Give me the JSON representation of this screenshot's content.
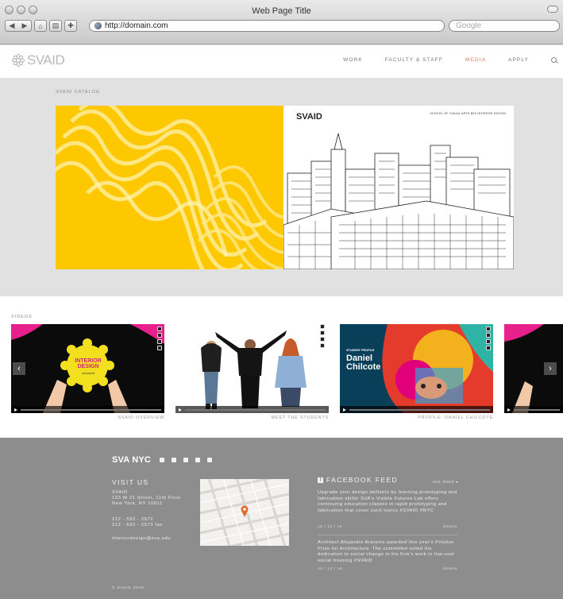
{
  "browser": {
    "title": "Web Page Title",
    "url": "http://domain.com",
    "search_placeholder": "Google"
  },
  "site": {
    "logo_text": "SVAID",
    "nav": [
      {
        "label": "WORK",
        "active": false
      },
      {
        "label": "FACULTY & STAFF",
        "active": false
      },
      {
        "label": "MEDIA",
        "active": true
      },
      {
        "label": "APPLY",
        "active": false
      }
    ],
    "active_color": "#e8766a"
  },
  "catalog": {
    "label": "SVAID CATALOG",
    "cover_logo": "SVAID",
    "cover_subtitle": "SCHOOL OF VISUAL ARTS BFA INTERIOR DESIGN",
    "accent": "#fdc800"
  },
  "videos": {
    "label": "VIDEOS",
    "items": [
      {
        "caption": "SVAID OVERVIEW",
        "overlay": "INTERIOR DESIGN",
        "overlay_small": "sva.edu/id"
      },
      {
        "caption": "MEET THE STUDENTS"
      },
      {
        "caption": "PROFILE: DANIEL CHILCOTE",
        "overlay_small": "STUDENT PROFILE",
        "overlay": "Daniel Chilcote"
      }
    ]
  },
  "footer": {
    "brand": "SVA NYC",
    "visit_heading": "VISIT US",
    "address": [
      "SVAID",
      "133 W 21 Street, 11th Floor",
      "New York, NY 10011"
    ],
    "phones": [
      "212 - 592 - 2572",
      "212 - 592 - 2573 fax"
    ],
    "email": "interiordesign@sva.edu",
    "fb_heading": "FACEBOOK FEED",
    "see_more": "see more",
    "posts": [
      {
        "text": "Upgrade your design skillsets by learning prototyping and fabrication skills! SVA's Visible Futures Lab offers continuing education classes in rapid prototyping and fabrication that cover such topics #SVAID #NYC",
        "date": "10 / 12 / 16",
        "link": "details"
      },
      {
        "text": "Architect Alejandro Aravena awarded this year's Pritzker Prize for Architecture. The committee noted his dedication to social change in his firm's work in low-cost social housing #SVAID",
        "date": "10 / 12 / 16",
        "link": "details"
      }
    ],
    "copyright": "© SVAID 2016"
  }
}
